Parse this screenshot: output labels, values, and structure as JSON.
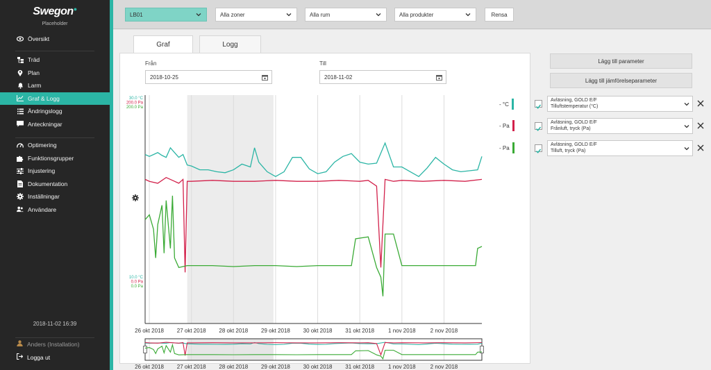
{
  "sidebar": {
    "logo": "Swegon",
    "logo_sub": "Placeholder",
    "group1": [
      {
        "label": "Översikt",
        "icon": "eye-icon"
      }
    ],
    "group2": [
      {
        "label": "Träd",
        "icon": "tree-icon"
      },
      {
        "label": "Plan",
        "icon": "map-pin-icon"
      },
      {
        "label": "Larm",
        "icon": "bell-icon"
      },
      {
        "label": "Graf & Logg",
        "icon": "chart-icon",
        "active": true
      },
      {
        "label": "Ändringslogg",
        "icon": "list-icon"
      },
      {
        "label": "Anteckningar",
        "icon": "comment-icon"
      }
    ],
    "group3": [
      {
        "label": "Optimering",
        "icon": "gauge-icon"
      },
      {
        "label": "Funktionsgrupper",
        "icon": "puzzle-icon"
      },
      {
        "label": "Injustering",
        "icon": "sliders-icon"
      },
      {
        "label": "Dokumentation",
        "icon": "document-icon"
      },
      {
        "label": "Inställningar",
        "icon": "gear-icon"
      },
      {
        "label": "Användare",
        "icon": "users-icon"
      }
    ],
    "timestamp": "2018-11-02 16:39",
    "user": "Anders (Installation)",
    "logout": "Logga ut"
  },
  "topbar": {
    "building": "LB01",
    "zones": "Alla zoner",
    "rooms": "Alla rum",
    "products": "Alla produkter",
    "clear": "Rensa"
  },
  "tabs": [
    "Graf",
    "Logg"
  ],
  "date": {
    "from_label": "Från",
    "from_value": "2018-10-25",
    "to_label": "Till",
    "to_value": "2018-11-02"
  },
  "right": {
    "add_param": "Lägg till parameter",
    "add_compare": "Lägg till jämförelseparameter",
    "params": [
      {
        "line1": "Avläsning, GOLD E/F",
        "line2": "Tilluftstemperatur (°C)"
      },
      {
        "line1": "Avläsning, GOLD E/F",
        "line2": "Frånluft, tryck (Pa)"
      },
      {
        "line1": "Avläsning, GOLD E/F",
        "line2": "Tilluft, tryck (Pa)"
      }
    ]
  },
  "legend": [
    {
      "label": "- °C",
      "color": "#2bb5a5"
    },
    {
      "label": "- Pa",
      "color": "#d2204a"
    },
    {
      "label": "- Pa",
      "color": "#3aaa35"
    }
  ],
  "chart_data": {
    "type": "line",
    "x_ticks": [
      "26 okt 2018",
      "27 okt 2018",
      "28 okt 2018",
      "29 okt 2018",
      "30 okt 2018",
      "31 okt 2018",
      "1 nov 2018",
      "2 nov 2018"
    ],
    "y_max_labels": [
      "30.0 °C",
      "200.0 Pa",
      "200.0 Pa"
    ],
    "y_min_labels": [
      "10.0 °C",
      "0.0 Pa",
      "0.0 Pa"
    ],
    "x_range_days": [
      25.9,
      33.9
    ],
    "highlight_range_days": [
      26.9,
      28.95
    ],
    "series": [
      {
        "name": "Tilluftstemperatur (°C)",
        "color": "#2bb5a5",
        "x": [
          25.9,
          26.0,
          26.1,
          26.2,
          26.3,
          26.4,
          26.5,
          26.6,
          26.7,
          26.8,
          26.9,
          27.0,
          27.2,
          27.4,
          27.6,
          27.8,
          28.0,
          28.2,
          28.4,
          28.5,
          28.6,
          28.8,
          29.0,
          29.2,
          29.4,
          29.6,
          29.8,
          30.0,
          30.2,
          30.4,
          30.6,
          30.8,
          31.0,
          31.2,
          31.4,
          31.6,
          31.8,
          32.0,
          32.2,
          32.4,
          32.6,
          32.8,
          33.0,
          33.2,
          33.4,
          33.6,
          33.8,
          33.9
        ],
        "y": [
          23.8,
          23.6,
          23.8,
          24.0,
          23.7,
          23.5,
          24.5,
          24.0,
          23.5,
          23.8,
          22.7,
          22.6,
          22.2,
          22.2,
          22.0,
          21.9,
          22.2,
          22.8,
          22.5,
          24.5,
          23.0,
          22.0,
          21.5,
          22.0,
          23.5,
          23.5,
          22.3,
          21.8,
          22.0,
          23.0,
          23.6,
          23.9,
          23.0,
          22.8,
          22.9,
          25.0,
          22.5,
          22.5,
          22.0,
          21.5,
          22.4,
          23.5,
          22.8,
          22.2,
          22.0,
          22.1,
          22.2,
          23.6
        ]
      },
      {
        "name": "Frånluft, tryck (Pa)",
        "color": "#d2204a",
        "x": [
          25.9,
          26.0,
          26.2,
          26.4,
          26.6,
          26.7,
          26.8,
          26.85,
          26.9,
          27.0,
          27.5,
          28.0,
          28.5,
          29.0,
          29.5,
          30.0,
          30.5,
          31.0,
          31.2,
          31.4,
          31.5,
          31.6,
          31.8,
          32.0,
          32.5,
          33.0,
          33.5,
          33.9
        ],
        "y": [
          112,
          110,
          108,
          114,
          110,
          108,
          112,
          15,
          110,
          110,
          111,
          110,
          110,
          111,
          110,
          110,
          111,
          110,
          111,
          105,
          20,
          112,
          110,
          111,
          110,
          111,
          110,
          112
        ]
      },
      {
        "name": "Tilluft, tryck (Pa)",
        "color": "#3aaa35",
        "x": [
          25.9,
          26.0,
          26.1,
          26.15,
          26.2,
          26.3,
          26.35,
          26.4,
          26.5,
          26.55,
          26.6,
          26.7,
          26.9,
          27.0,
          27.5,
          28.0,
          28.5,
          29.0,
          29.5,
          30.0,
          30.5,
          30.8,
          30.9,
          31.2,
          31.4,
          31.5,
          31.55,
          31.6,
          31.8,
          32.0,
          32.5,
          33.0,
          33.5,
          33.75,
          33.8,
          33.9
        ],
        "y": [
          70,
          75,
          60,
          30,
          65,
          85,
          35,
          90,
          40,
          95,
          30,
          20,
          22,
          22,
          22,
          21,
          22,
          22,
          21,
          22,
          22,
          22,
          50,
          52,
          20,
          10,
          -10,
          55,
          55,
          22,
          22,
          22,
          22,
          22,
          40,
          42
        ]
      }
    ]
  }
}
